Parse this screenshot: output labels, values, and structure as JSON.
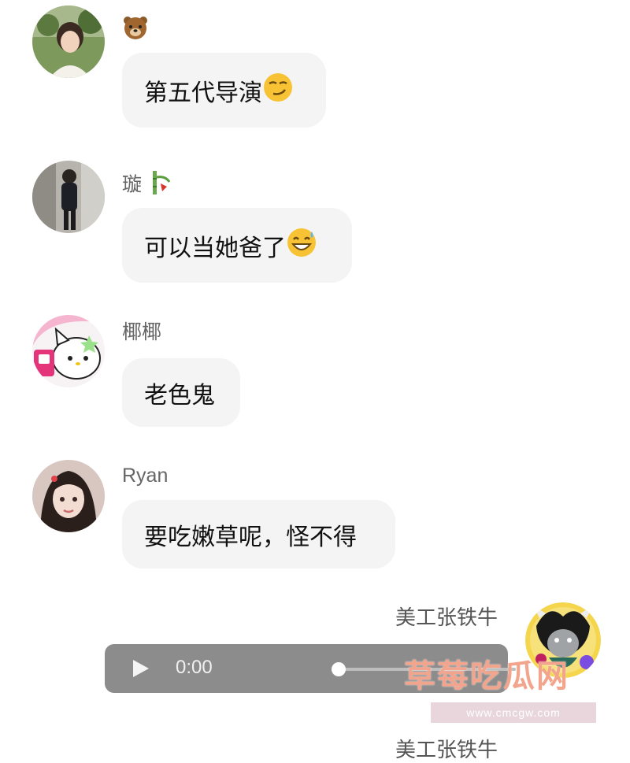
{
  "messages": [
    {
      "sender": "",
      "sender_emoji": "bear-icon",
      "text": "第五代导演",
      "text_emoji": "smirk-icon"
    },
    {
      "sender": "璇",
      "sender_emoji": "bamboo-icon",
      "text": "可以当她爸了",
      "text_emoji": "grin-sweat-icon"
    },
    {
      "sender": "椰椰",
      "text": "老色鬼"
    },
    {
      "sender": "Ryan",
      "text": "要吃嫩草呢，怪不得"
    }
  ],
  "self": {
    "sender": "美工张铁牛",
    "audio": {
      "time": "0:00",
      "progress": 0
    },
    "sender_partial": "美工张铁牛"
  },
  "watermark": {
    "title": "草莓吃瓜网",
    "url": "www.cmcgw.com"
  },
  "colors": {
    "bubble": "#f4f4f4",
    "audio_bg": "#8c8c8c",
    "sender_text": "#666666"
  }
}
